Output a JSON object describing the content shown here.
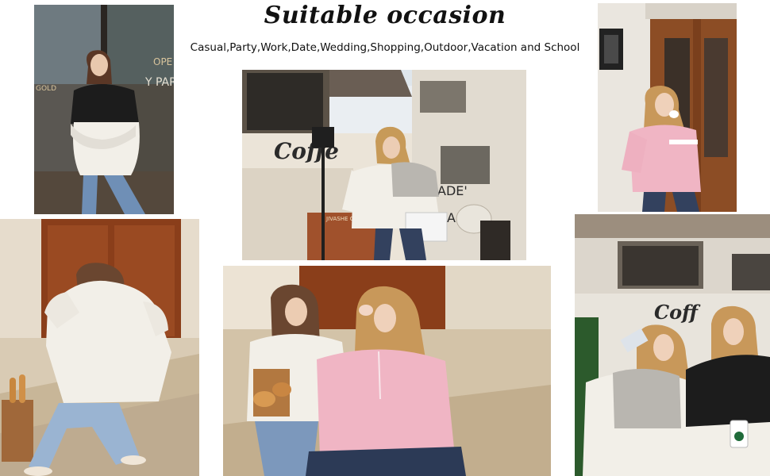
{
  "header": {
    "title": "Suitable occasion",
    "subtitle": "Casual,Party,Work,Date,Wedding,Shopping,Outdoor,Vacation and School"
  },
  "photos": {
    "p1": {
      "sign_top": "OPE",
      "sign_mid": "Y PAR",
      "sign_left": "GOLD"
    },
    "p2": {
      "shop_sign": "Coffe",
      "wall_text": "ADE'",
      "wall_letter": "A",
      "small_sign": "JIVASHE CHIN"
    },
    "p6": {
      "shop_sign": "Coff"
    }
  },
  "colors": {
    "sweater_white": "#f2efe8",
    "sweater_pink": "#f0b5c4",
    "sweater_black": "#1c1c1c",
    "sweater_gray": "#b9b6b0",
    "jeans": "#6f8fb6",
    "wall_cream": "#ece4d6",
    "door_wood": "#8b4a24"
  }
}
